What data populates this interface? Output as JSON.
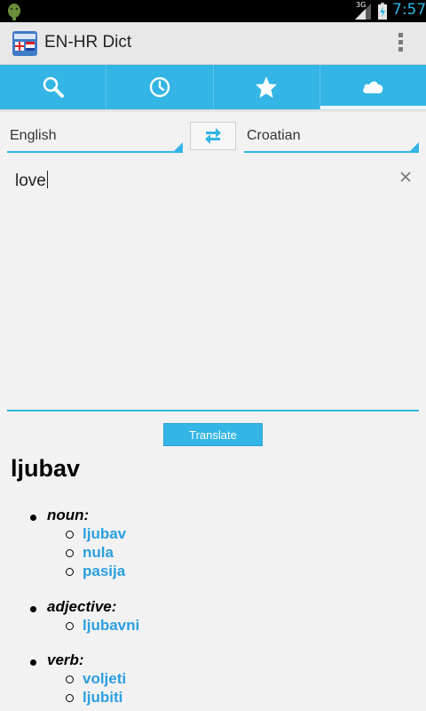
{
  "status_bar": {
    "time": "7:57",
    "network": "3G",
    "icons": [
      "android-debug-icon",
      "signal-icon",
      "battery-charging-icon"
    ]
  },
  "action_bar": {
    "title": "EN-HR Dict",
    "app_icon": "dictionary-app-icon",
    "overflow_icon": "overflow-menu-icon"
  },
  "tabs": [
    {
      "icon": "search-icon",
      "active": false
    },
    {
      "icon": "history-clock-icon",
      "active": false
    },
    {
      "icon": "favorites-star-icon",
      "active": false
    },
    {
      "icon": "cloud-icon",
      "active": true
    }
  ],
  "languages": {
    "source": "English",
    "target": "Croatian",
    "swap_icon": "swap-arrows-icon"
  },
  "input": {
    "value": "love",
    "clear_icon": "clear-x-icon"
  },
  "translate_label": "Translate",
  "result": {
    "word": "ljubav",
    "groups": [
      {
        "pos": "noun:",
        "translations": [
          "ljubav",
          "nula",
          "pasija"
        ]
      },
      {
        "pos": "adjective:",
        "translations": [
          "ljubavni"
        ]
      },
      {
        "pos": "verb:",
        "translations": [
          "voljeti",
          "ljubiti"
        ]
      }
    ]
  },
  "colors": {
    "accent": "#33b5e5",
    "link": "#2a9fe0",
    "status_time": "#33b5e5"
  }
}
